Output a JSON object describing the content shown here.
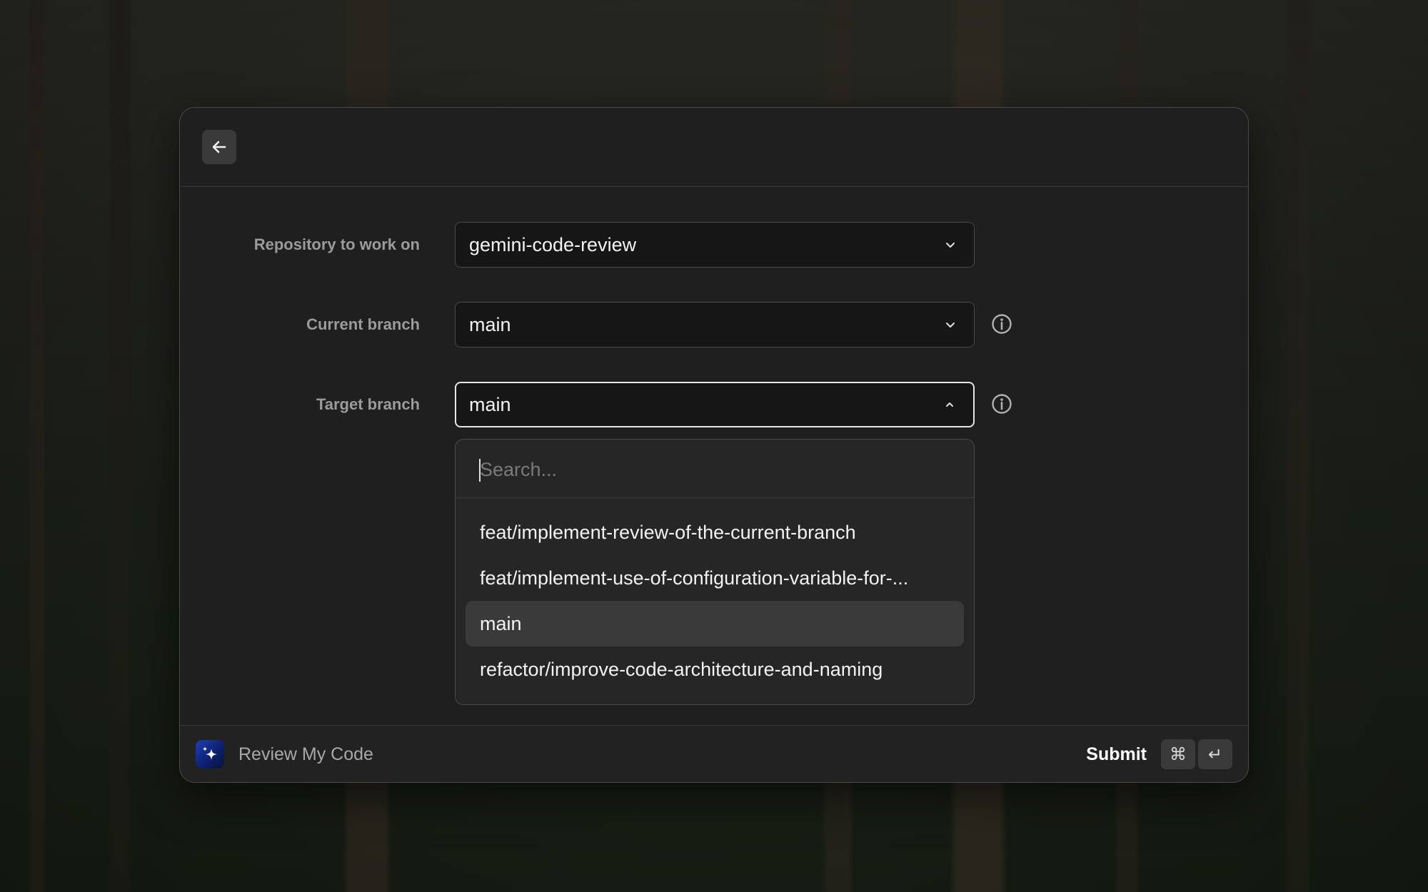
{
  "app": {
    "name": "Review My Code"
  },
  "form": {
    "repository": {
      "label": "Repository to work on",
      "value": "gemini-code-review"
    },
    "current_branch": {
      "label": "Current branch",
      "value": "main"
    },
    "target_branch": {
      "label": "Target branch",
      "value": "main"
    }
  },
  "dropdown": {
    "search_placeholder": "Search...",
    "items": [
      {
        "label": "feat/implement-review-of-the-current-branch",
        "selected": false
      },
      {
        "label": "feat/implement-use-of-configuration-variable-for-...",
        "selected": false
      },
      {
        "label": "main",
        "selected": true
      },
      {
        "label": "refactor/improve-code-architecture-and-naming",
        "selected": false
      }
    ]
  },
  "footer": {
    "submit_label": "Submit",
    "shortcut_keys": [
      "⌘",
      "↵"
    ]
  },
  "icons": {
    "back": "arrow-left-icon",
    "chevron_down": "chevron-down-icon",
    "chevron_up": "chevron-up-icon",
    "info": "info-icon",
    "app": "sparkle-icon"
  },
  "colors": {
    "window_bg": "#1f1f1f",
    "input_bg": "#161616",
    "selected_item_bg": "#3a3a3a",
    "app_icon_gradient": [
      "#1c3fb5",
      "#081338"
    ]
  }
}
